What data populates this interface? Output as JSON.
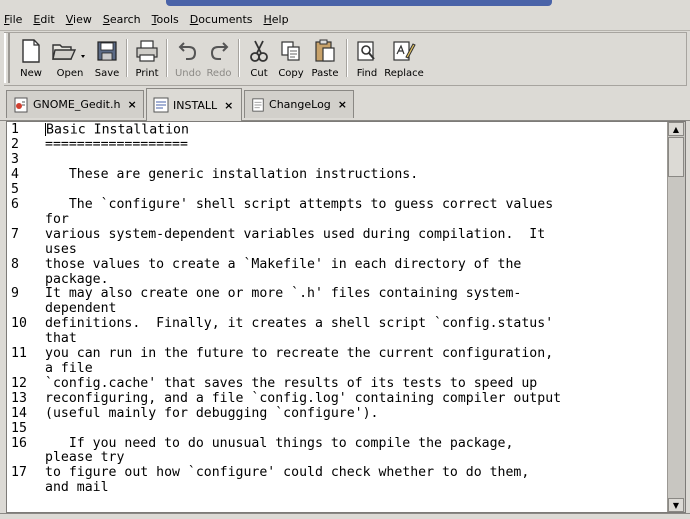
{
  "menu": [
    "File",
    "Edit",
    "View",
    "Search",
    "Tools",
    "Documents",
    "Help"
  ],
  "toolbar": {
    "new": "New",
    "open": "Open",
    "save": "Save",
    "print": "Print",
    "undo": "Undo",
    "redo": "Redo",
    "cut": "Cut",
    "copy": "Copy",
    "paste": "Paste",
    "find": "Find",
    "replace": "Replace"
  },
  "tabs": [
    {
      "label": "GNOME_Gedit.h",
      "close": "×"
    },
    {
      "label": "INSTALL",
      "close": "×"
    },
    {
      "label": "ChangeLog",
      "close": "×"
    }
  ],
  "editor": {
    "lines": [
      {
        "num": "1",
        "text": "Basic Installation"
      },
      {
        "num": "2",
        "text": "=================="
      },
      {
        "num": "3",
        "text": ""
      },
      {
        "num": "4",
        "text": "   These are generic installation instructions."
      },
      {
        "num": "5",
        "text": ""
      },
      {
        "num": "6",
        "text": "   The `configure' shell script attempts to guess correct values"
      },
      {
        "num": "",
        "text": "for"
      },
      {
        "num": "7",
        "text": "various system-dependent variables used during compilation.  It"
      },
      {
        "num": "",
        "text": "uses"
      },
      {
        "num": "8",
        "text": "those values to create a `Makefile' in each directory of the"
      },
      {
        "num": "",
        "text": "package."
      },
      {
        "num": "9",
        "text": "It may also create one or more `.h' files containing system-"
      },
      {
        "num": "",
        "text": "dependent"
      },
      {
        "num": "10",
        "text": "definitions.  Finally, it creates a shell script `config.status'"
      },
      {
        "num": "",
        "text": "that"
      },
      {
        "num": "11",
        "text": "you can run in the future to recreate the current configuration,"
      },
      {
        "num": "",
        "text": "a file"
      },
      {
        "num": "12",
        "text": "`config.cache' that saves the results of its tests to speed up"
      },
      {
        "num": "13",
        "text": "reconfiguring, and a file `config.log' containing compiler output"
      },
      {
        "num": "14",
        "text": "(useful mainly for debugging `configure')."
      },
      {
        "num": "15",
        "text": ""
      },
      {
        "num": "16",
        "text": "   If you need to do unusual things to compile the package,"
      },
      {
        "num": "",
        "text": "please try"
      },
      {
        "num": "17",
        "text": "to figure out how `configure' could check whether to do them,"
      },
      {
        "num": "",
        "text": "and mail"
      }
    ]
  },
  "colors": {
    "accent": "#4a63a8",
    "window_bg": "#dcdad5"
  }
}
